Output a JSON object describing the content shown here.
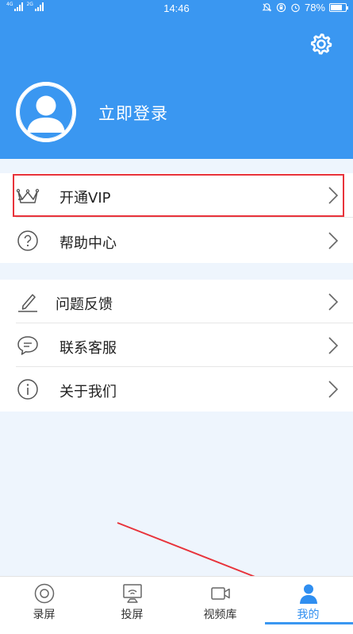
{
  "status_bar": {
    "network_left": "4G",
    "network_right": "2G",
    "time": "14:46",
    "battery_percent": "78%",
    "battery_level": 0.78
  },
  "header": {
    "login_text": "立即登录",
    "background_color": "#3a97f1"
  },
  "menu": {
    "group1": [
      {
        "label": "开通VIP",
        "icon": "crown-icon"
      },
      {
        "label": "帮助中心",
        "icon": "question-circle-icon"
      }
    ],
    "group2": [
      {
        "label": "问题反馈",
        "icon": "pen-icon"
      },
      {
        "label": "联系客服",
        "icon": "chat-bubble-icon"
      },
      {
        "label": "关于我们",
        "icon": "info-circle-icon"
      }
    ],
    "highlight_color": "#e8333b"
  },
  "bottom_nav": {
    "items": [
      {
        "label": "录屏",
        "icon": "record-icon"
      },
      {
        "label": "投屏",
        "icon": "cast-icon"
      },
      {
        "label": "视频库",
        "icon": "video-camera-icon"
      },
      {
        "label": "我的",
        "icon": "person-icon"
      }
    ],
    "active_index": 3,
    "active_color": "#2f8ef0"
  }
}
